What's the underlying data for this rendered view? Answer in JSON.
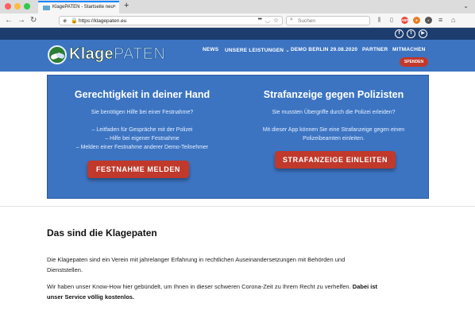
{
  "browser": {
    "tab_title": "KlagePATEN - Startseite neu",
    "tab_close": "×",
    "new_tab": "+",
    "url": "https://klagepaten.eu",
    "url_more": "•••",
    "search_placeholder": "Suchen",
    "icons": [
      "back-icon",
      "forward-icon",
      "reload-icon",
      "shield-icon",
      "lock-icon",
      "pocket-icon",
      "star-icon",
      "library-icon",
      "sidebar-icon",
      "menu-icon",
      "search-icon",
      "home-icon"
    ]
  },
  "social": [
    "f",
    "t",
    "▶"
  ],
  "header": {
    "logo_part1": "Klage",
    "logo_part2": "PATEN",
    "nav": [
      "NEWS",
      "UNSERE LEISTUNGEN ⌄",
      "DEMO BERLIN 29.08.2020",
      "PARTNER",
      "MITMACHEN"
    ],
    "donate": "SPENDEN"
  },
  "hero": {
    "left_title": "Gerechtigkeit in deiner Hand",
    "left_subtitle": "Sie benötigen Hilfe bei einer Festnahme?",
    "left_list": [
      "– Leitfaden für Gespräche mit der Polizei",
      "– Hilfe bei eigener Festnahme",
      "– Melden einer Festnahme anderer Demo-Teilnehmer"
    ],
    "left_button": "FESTNAHME MELDEN",
    "right_title": "Strafanzeige gegen Polizisten",
    "right_subtitle": "Sie mussten Übergriffe durch die Polizei erleiden?",
    "right_text1": "Mit dieser App können Sie eine Strafanzeige gegen einen",
    "right_text2": "Polizeibeamten einleiten.",
    "right_button": "STRAFANZEIGE EINLEITEN"
  },
  "content": {
    "title": "Das sind die Klagepaten",
    "p1_line1": "Die Klagepaten sind ein Verein mit jahrelanger Erfahrung in rechtlichen Auseinandersetzungen mit Behörden und",
    "p1_line2": "Dienststellen.",
    "p2_line1": "Wir haben unser Know-How hier gebündelt, um Ihnen in dieser schweren Corona-Zeit zu Ihrem Recht zu verhelfen.",
    "p2_bold1": "Dabei ist",
    "p2_bold2": "unser Service völlig kostenlos."
  },
  "colors": {
    "brand_blue": "#3c74c2",
    "dark_blue": "#1d3d6e",
    "accent_red": "#c0392b"
  }
}
